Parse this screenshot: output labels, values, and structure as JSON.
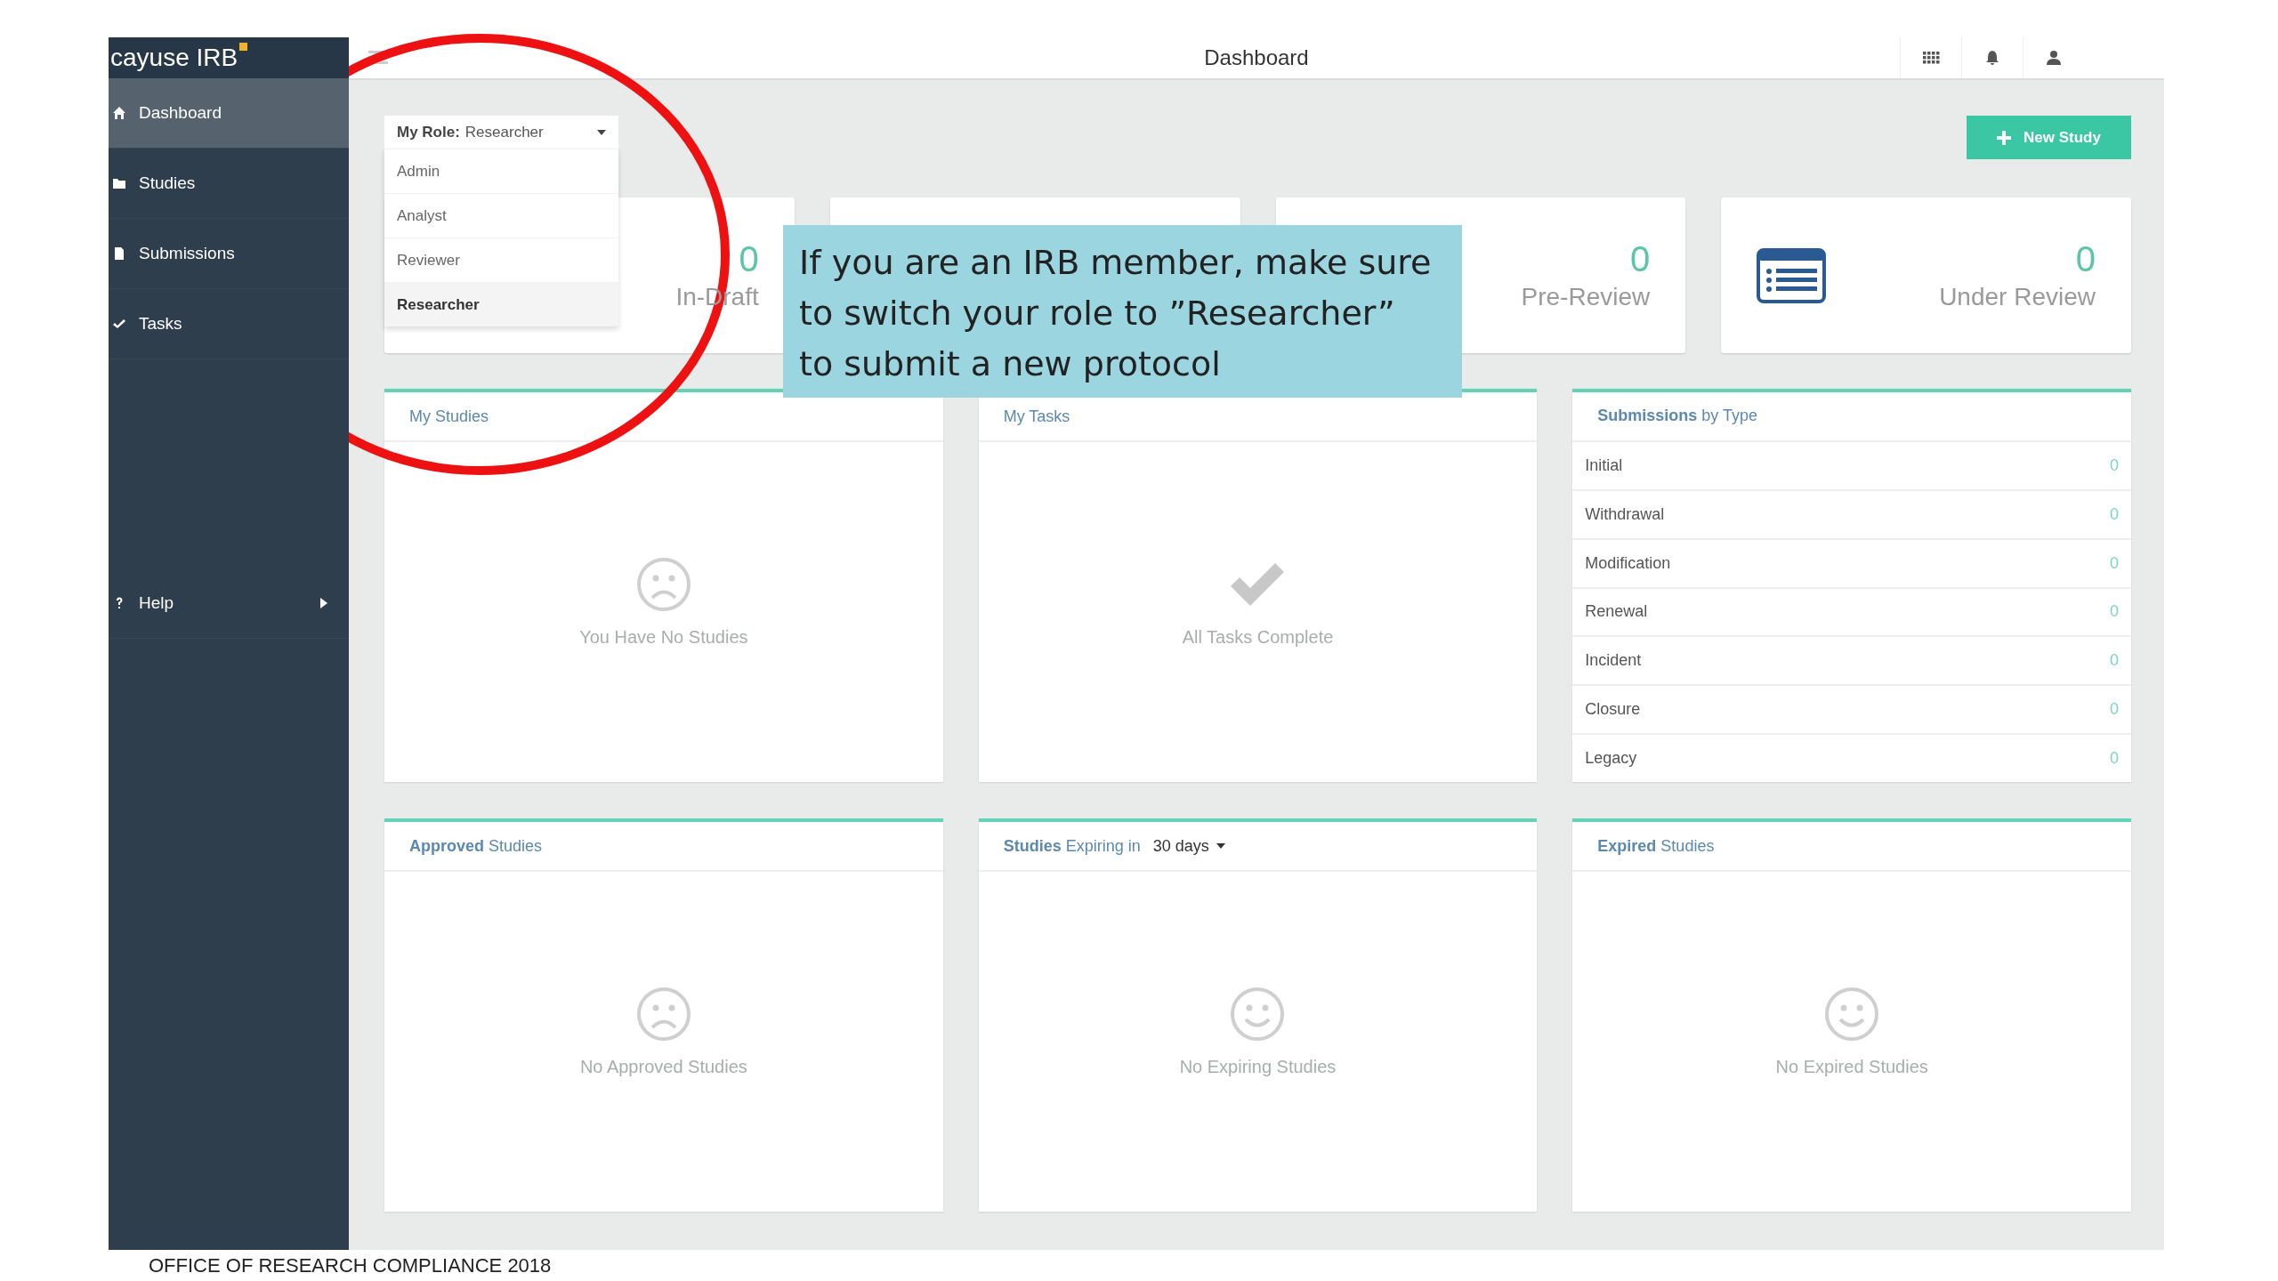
{
  "app": {
    "brand": "cayuse IRB"
  },
  "sidebar": {
    "items": [
      {
        "label": "Dashboard",
        "selected": true,
        "expandable": false
      },
      {
        "label": "Studies",
        "selected": false,
        "expandable": false
      },
      {
        "label": "Submissions",
        "selected": false,
        "expandable": false
      },
      {
        "label": "Tasks",
        "selected": false,
        "expandable": false
      },
      {
        "label": "Help",
        "selected": false,
        "expandable": true
      }
    ]
  },
  "topbar": {
    "title": "Dashboard"
  },
  "role_menu": {
    "label": "My Role:",
    "value": "Researcher",
    "options": [
      {
        "label": "Admin",
        "selected": false
      },
      {
        "label": "Analyst",
        "selected": false
      },
      {
        "label": "Reviewer",
        "selected": false
      },
      {
        "label": "Researcher",
        "selected": true
      }
    ]
  },
  "new_study_button": {
    "label": "New Study"
  },
  "stat_cards": [
    {
      "kind": "stat",
      "count": "0",
      "label": "In-Draft"
    },
    {
      "kind": "blank"
    },
    {
      "kind": "stat",
      "count": "0",
      "label": "Pre-Review"
    },
    {
      "kind": "stat_icon",
      "count": "0",
      "label": "Under Review"
    }
  ],
  "panels": [
    {
      "kind": "sad",
      "title": "My Studies",
      "empty_text": "You Have No Studies"
    },
    {
      "kind": "check",
      "title": "My Tasks",
      "empty_text": "All Tasks Complete"
    },
    {
      "kind": "list",
      "title": "**Submissions** by Type",
      "rows": [
        {
          "label": "Initial",
          "count": "0"
        },
        {
          "label": "Withdrawal",
          "count": "0"
        },
        {
          "label": "Modification",
          "count": "0"
        },
        {
          "label": "Renewal",
          "count": "0"
        },
        {
          "label": "Incident",
          "count": "0"
        },
        {
          "label": "Closure",
          "count": "0"
        },
        {
          "label": "Legacy",
          "count": "0"
        }
      ]
    },
    {
      "kind": "sad",
      "title": "**Approved** Studies",
      "empty_text": "No Approved Studies"
    },
    {
      "kind": "happy",
      "title": "**Studies** Expiring in",
      "filter": "30 days",
      "empty_text": "No Expiring Studies"
    },
    {
      "kind": "happy",
      "title": "**Expired** Studies",
      "empty_text": "No Expired Studies"
    }
  ],
  "callout": {
    "lines": [
      "If you are an IRB member, make sure",
      "to switch your role to ”Researcher”",
      "to submit a new protocol"
    ]
  },
  "footer": {
    "text": "OFFICE OF RESEARCH COMPLIANCE 2018"
  }
}
